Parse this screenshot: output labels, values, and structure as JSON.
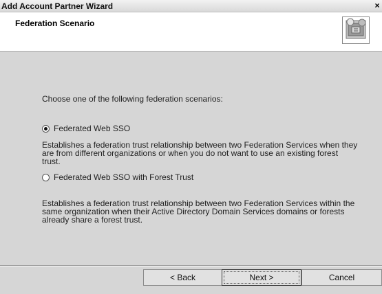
{
  "window": {
    "title": "Add Account Partner Wizard",
    "close_glyph": "×"
  },
  "header": {
    "title": "Federation Scenario",
    "icon": "wizard-icon"
  },
  "content": {
    "prompt": "Choose one of the following federation scenarios:",
    "options": [
      {
        "label": "Federated Web SSO",
        "selected": true,
        "description_lines": [
          "Establishes a federation trust relationship between two Federation Services when they",
          "are from different organizations or when you do not want to use an existing forest",
          "trust."
        ]
      },
      {
        "label": "Federated Web SSO with Forest Trust",
        "selected": false,
        "description_lines": [
          "Establishes a federation trust relationship between two Federation Services within the",
          "same organization when their Active Directory Domain Services domains or forests",
          "already share a forest trust."
        ]
      }
    ]
  },
  "buttons": {
    "back": "< Back",
    "next": "Next >",
    "cancel": "Cancel"
  }
}
